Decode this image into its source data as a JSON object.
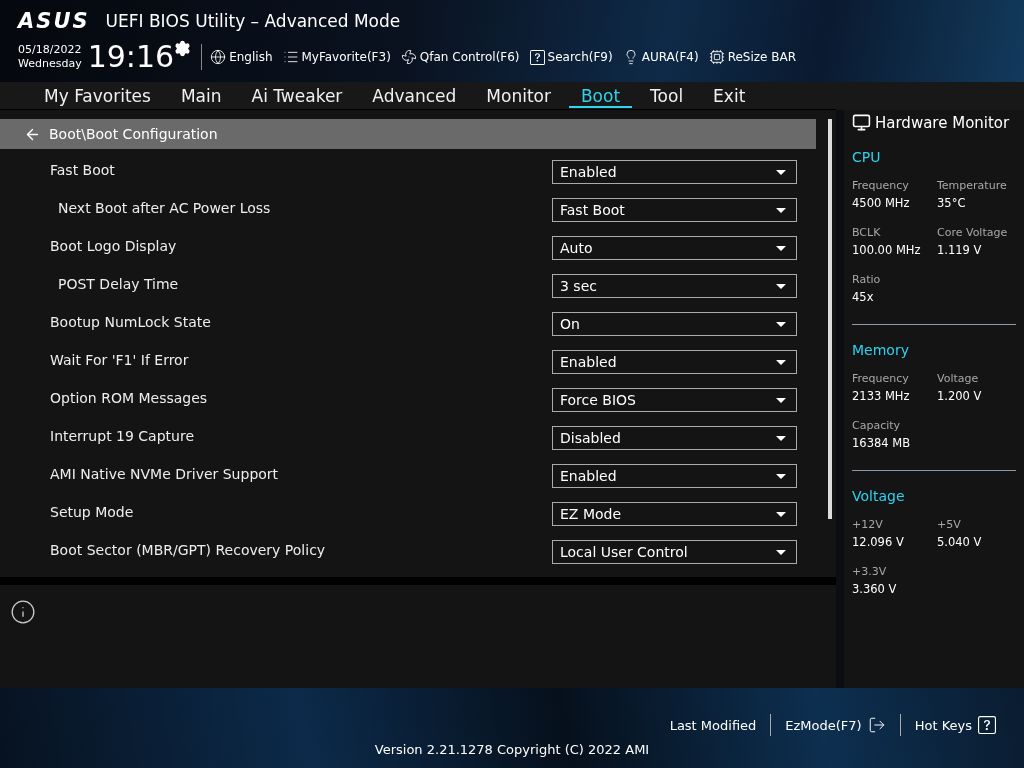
{
  "header": {
    "logo": "ASUS",
    "title": "UEFI BIOS Utility – Advanced Mode",
    "date": "05/18/2022",
    "weekday": "Wednesday",
    "time": "19:16",
    "tools": [
      {
        "label": "English"
      },
      {
        "label": "MyFavorite(F3)"
      },
      {
        "label": "Qfan Control(F6)"
      },
      {
        "label": "Search(F9)"
      },
      {
        "label": "AURA(F4)"
      },
      {
        "label": "ReSize BAR"
      }
    ]
  },
  "tabs": [
    {
      "label": "My Favorites",
      "selected": false
    },
    {
      "label": "Main",
      "selected": false
    },
    {
      "label": "Ai Tweaker",
      "selected": false
    },
    {
      "label": "Advanced",
      "selected": false
    },
    {
      "label": "Monitor",
      "selected": false
    },
    {
      "label": "Boot",
      "selected": true
    },
    {
      "label": "Tool",
      "selected": false
    },
    {
      "label": "Exit",
      "selected": false
    }
  ],
  "breadcrumb": "Boot\\Boot Configuration",
  "settings": [
    {
      "label": "Fast Boot",
      "value": "Enabled",
      "children": [
        {
          "label": "Next Boot after AC Power Loss",
          "value": "Fast Boot"
        }
      ]
    },
    {
      "label": "Boot Logo Display",
      "value": "Auto",
      "children": [
        {
          "label": "POST Delay Time",
          "value": "3 sec"
        }
      ]
    },
    {
      "label": "Bootup NumLock State",
      "value": "On"
    },
    {
      "label": "Wait For 'F1' If Error",
      "value": "Enabled"
    },
    {
      "label": "Option ROM Messages",
      "value": "Force BIOS"
    },
    {
      "label": "Interrupt 19 Capture",
      "value": "Disabled"
    },
    {
      "label": "AMI Native NVMe Driver Support",
      "value": "Enabled"
    },
    {
      "label": "Setup Mode",
      "value": "EZ Mode"
    },
    {
      "label": "Boot Sector (MBR/GPT) Recovery Policy",
      "value": "Local User Control"
    }
  ],
  "hardware_monitor": {
    "title": "Hardware Monitor",
    "sections": [
      {
        "title": "CPU",
        "items": [
          {
            "label": "Frequency",
            "value": "4500 MHz"
          },
          {
            "label": "Temperature",
            "value": "35°C"
          },
          {
            "label": "BCLK",
            "value": "100.00 MHz"
          },
          {
            "label": "Core Voltage",
            "value": "1.119 V"
          },
          {
            "label": "Ratio",
            "value": "45x"
          }
        ]
      },
      {
        "title": "Memory",
        "items": [
          {
            "label": "Frequency",
            "value": "2133 MHz"
          },
          {
            "label": "Voltage",
            "value": "1.200 V"
          },
          {
            "label": "Capacity",
            "value": "16384 MB"
          }
        ]
      },
      {
        "title": "Voltage",
        "items": [
          {
            "label": "+12V",
            "value": "12.096 V"
          },
          {
            "label": "+5V",
            "value": "5.040 V"
          },
          {
            "label": "+3.3V",
            "value": "3.360 V"
          }
        ]
      }
    ]
  },
  "footer": {
    "actions": [
      {
        "label": "Last Modified"
      },
      {
        "label": "EzMode(F7)"
      },
      {
        "label": "Hot Keys"
      }
    ],
    "version": "Version 2.21.1278 Copyright (C) 2022 AMI"
  }
}
